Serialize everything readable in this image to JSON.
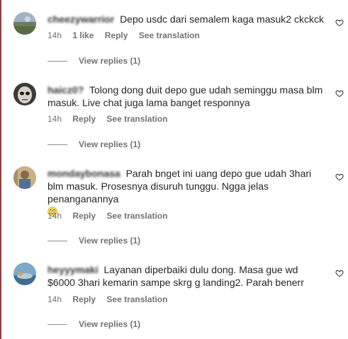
{
  "comments": [
    {
      "username": "cheezywarrior",
      "text": "Depo usdc dari semalem kaga masuk2 ckckck",
      "time": "14h",
      "likes": "1 like",
      "reply": "Reply",
      "translate": "See translation",
      "view_replies": "View replies (1)"
    },
    {
      "username": "haicz0?",
      "text": "Tolong dong duit depo gue udah seminggu masa blm masuk. Live chat juga lama banget responnya",
      "time": "14h",
      "reply": "Reply",
      "translate": "See translation",
      "view_replies": "View replies (1)"
    },
    {
      "username": "mondaybonasa",
      "text": "Parah bnget ini uang depo gue udah 3hari blm masuk. Prosesnya disuruh tunggu. Ngga jelas penanganannya",
      "time": "14h",
      "reply": "Reply",
      "translate": "See translation",
      "view_replies": "View replies (1)"
    },
    {
      "username": "heyyymaki",
      "text": "Layanan diperbaiki dulu dong. Masa gue wd $6000 3hari kemarin sampe skrg g landing2. Parah benerr",
      "time": "14h",
      "reply": "Reply",
      "translate": "See translation",
      "view_replies": "View replies (1)"
    }
  ],
  "icons": {
    "heart": "heart-outline-icon",
    "emoji": "rolling-eyes-emoji-icon"
  },
  "colors": {
    "text": "#262626",
    "muted": "#737373",
    "edge": "#8f3f3f"
  }
}
